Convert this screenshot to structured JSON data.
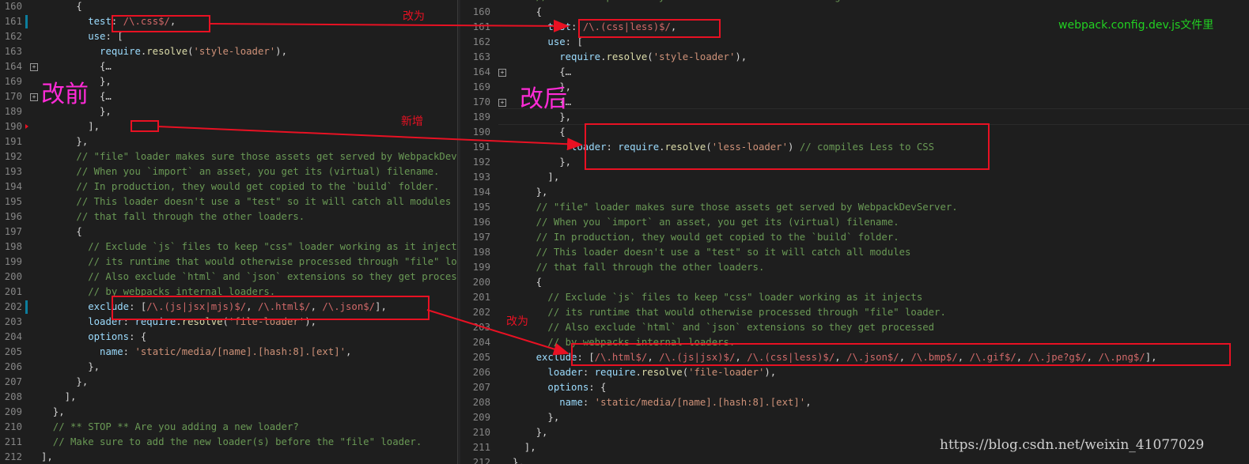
{
  "left": {
    "first_line": 160,
    "lines": [
      {
        "n": "160",
        "t": [
          [
            "      {",
            "pl"
          ]
        ]
      },
      {
        "n": "161",
        "t": [
          [
            "        ",
            "pl"
          ],
          [
            "test",
            "kw"
          ],
          [
            ": ",
            "pl"
          ],
          [
            "/\\.css$/",
            "rx"
          ],
          [
            ",",
            "pl"
          ]
        ],
        "mod": true
      },
      {
        "n": "162",
        "t": [
          [
            "        ",
            "pl"
          ],
          [
            "use",
            "kw"
          ],
          [
            ": [",
            "pl"
          ]
        ]
      },
      {
        "n": "163",
        "t": [
          [
            "          ",
            "pl"
          ],
          [
            "require",
            "kw"
          ],
          [
            ".",
            "pl"
          ],
          [
            "resolve",
            "fn"
          ],
          [
            "(",
            "pl"
          ],
          [
            "'style-loader'",
            "st"
          ],
          [
            "),",
            "pl"
          ]
        ]
      },
      {
        "n": "164",
        "t": [
          [
            "          {…",
            "pl"
          ]
        ],
        "fold": true
      },
      {
        "n": "169",
        "t": [
          [
            "          },",
            "pl"
          ]
        ]
      },
      {
        "n": "170",
        "t": [
          [
            "          {…",
            "pl"
          ]
        ],
        "fold": true
      },
      {
        "n": "189",
        "t": [
          [
            "          },",
            "pl"
          ]
        ]
      },
      {
        "n": "190",
        "t": [
          [
            "        ],",
            "pl"
          ]
        ],
        "marker": true
      },
      {
        "n": "191",
        "t": [
          [
            "      },",
            "pl"
          ]
        ]
      },
      {
        "n": "192",
        "t": [
          [
            "      // \"file\" loader makes sure those assets get served by WebpackDevServer.",
            "cm"
          ]
        ]
      },
      {
        "n": "193",
        "t": [
          [
            "      // When you `import` an asset, you get its (virtual) filename.",
            "cm"
          ]
        ]
      },
      {
        "n": "194",
        "t": [
          [
            "      // In production, they would get copied to the `build` folder.",
            "cm"
          ]
        ]
      },
      {
        "n": "195",
        "t": [
          [
            "      // This loader doesn't use a \"test\" so it will catch all modules",
            "cm"
          ]
        ]
      },
      {
        "n": "196",
        "t": [
          [
            "      // that fall through the other loaders.",
            "cm"
          ]
        ]
      },
      {
        "n": "197",
        "t": [
          [
            "      {",
            "pl"
          ]
        ]
      },
      {
        "n": "198",
        "t": [
          [
            "        // Exclude `js` files to keep \"css\" loader working as it injects",
            "cm"
          ]
        ]
      },
      {
        "n": "199",
        "t": [
          [
            "        // its runtime that would otherwise processed through \"file\" loader.",
            "cm"
          ]
        ]
      },
      {
        "n": "200",
        "t": [
          [
            "        // Also exclude `html` and `json` extensions so they get processed",
            "cm"
          ]
        ]
      },
      {
        "n": "201",
        "t": [
          [
            "        // by webpacks internal loaders.",
            "cm"
          ]
        ]
      },
      {
        "n": "202",
        "t": [
          [
            "        ",
            "pl"
          ],
          [
            "exclude",
            "kw"
          ],
          [
            ": [",
            "pl"
          ],
          [
            "/\\.(js|jsx|mjs)$/",
            "rx"
          ],
          [
            ", ",
            "pl"
          ],
          [
            "/\\.html$/",
            "rx"
          ],
          [
            ", ",
            "pl"
          ],
          [
            "/\\.json$/",
            "rx"
          ],
          [
            "],",
            "pl"
          ]
        ],
        "mod": true
      },
      {
        "n": "203",
        "t": [
          [
            "        ",
            "pl"
          ],
          [
            "loader",
            "kw"
          ],
          [
            ": ",
            "pl"
          ],
          [
            "require",
            "kw"
          ],
          [
            ".",
            "pl"
          ],
          [
            "resolve",
            "fn"
          ],
          [
            "(",
            "pl"
          ],
          [
            "'file-loader'",
            "st"
          ],
          [
            "),",
            "pl"
          ]
        ]
      },
      {
        "n": "204",
        "t": [
          [
            "        ",
            "pl"
          ],
          [
            "options",
            "kw"
          ],
          [
            ": {",
            "pl"
          ]
        ]
      },
      {
        "n": "205",
        "t": [
          [
            "          ",
            "pl"
          ],
          [
            "name",
            "kw"
          ],
          [
            ": ",
            "pl"
          ],
          [
            "'static/media/[name].[hash:8].[ext]'",
            "st"
          ],
          [
            ",",
            "pl"
          ]
        ]
      },
      {
        "n": "206",
        "t": [
          [
            "        },",
            "pl"
          ]
        ]
      },
      {
        "n": "207",
        "t": [
          [
            "      },",
            "pl"
          ]
        ]
      },
      {
        "n": "208",
        "t": [
          [
            "    ],",
            "pl"
          ]
        ]
      },
      {
        "n": "209",
        "t": [
          [
            "  },",
            "pl"
          ]
        ]
      },
      {
        "n": "210",
        "t": [
          [
            "  // ** STOP ** Are you adding a new loader?",
            "cm"
          ]
        ]
      },
      {
        "n": "211",
        "t": [
          [
            "  // Make sure to add the new loader(s) before the \"file\" loader.",
            "cm"
          ]
        ]
      },
      {
        "n": "212",
        "t": [
          [
            "],",
            "pl"
          ]
        ]
      }
    ]
  },
  "right": {
    "lines": [
      {
        "n": "159",
        "t": [
          [
            "    // In development \"style\" loader enables hot editing of CSS.",
            "cm"
          ]
        ]
      },
      {
        "n": "160",
        "t": [
          [
            "    {",
            "pl"
          ]
        ]
      },
      {
        "n": "161",
        "t": [
          [
            "      ",
            "pl"
          ],
          [
            "test",
            "kw"
          ],
          [
            ": ",
            "pl"
          ],
          [
            "/\\.(css|less)$/",
            "rx"
          ],
          [
            ",",
            "pl"
          ]
        ]
      },
      {
        "n": "162",
        "t": [
          [
            "      ",
            "pl"
          ],
          [
            "use",
            "kw"
          ],
          [
            ": [",
            "pl"
          ]
        ]
      },
      {
        "n": "163",
        "t": [
          [
            "        ",
            "pl"
          ],
          [
            "require",
            "kw"
          ],
          [
            ".",
            "pl"
          ],
          [
            "resolve",
            "fn"
          ],
          [
            "(",
            "pl"
          ],
          [
            "'style-loader'",
            "st"
          ],
          [
            "),",
            "pl"
          ]
        ]
      },
      {
        "n": "164",
        "t": [
          [
            "        {…",
            "pl"
          ]
        ],
        "fold": true
      },
      {
        "n": "169",
        "t": [
          [
            "        },",
            "pl"
          ]
        ]
      },
      {
        "n": "170",
        "t": [
          [
            "        {…",
            "pl"
          ]
        ],
        "fold": true
      },
      {
        "n": "189",
        "t": [
          [
            "        },",
            "pl"
          ]
        ]
      },
      {
        "n": "190",
        "t": [
          [
            "        {",
            "pl"
          ]
        ]
      },
      {
        "n": "191",
        "t": [
          [
            "          ",
            "pl"
          ],
          [
            "loader",
            "kw"
          ],
          [
            ": ",
            "pl"
          ],
          [
            "require",
            "kw"
          ],
          [
            ".",
            "pl"
          ],
          [
            "resolve",
            "fn"
          ],
          [
            "(",
            "pl"
          ],
          [
            "'less-loader'",
            "st"
          ],
          [
            ") ",
            "pl"
          ],
          [
            "// compiles Less to CSS",
            "cm"
          ]
        ]
      },
      {
        "n": "192",
        "t": [
          [
            "        },",
            "pl"
          ]
        ]
      },
      {
        "n": "193",
        "t": [
          [
            "      ],",
            "pl"
          ]
        ]
      },
      {
        "n": "194",
        "t": [
          [
            "    },",
            "pl"
          ]
        ]
      },
      {
        "n": "195",
        "t": [
          [
            "    // \"file\" loader makes sure those assets get served by WebpackDevServer.",
            "cm"
          ]
        ]
      },
      {
        "n": "196",
        "t": [
          [
            "    // When you `import` an asset, you get its (virtual) filename.",
            "cm"
          ]
        ]
      },
      {
        "n": "197",
        "t": [
          [
            "    // In production, they would get copied to the `build` folder.",
            "cm"
          ]
        ]
      },
      {
        "n": "198",
        "t": [
          [
            "    // This loader doesn't use a \"test\" so it will catch all modules",
            "cm"
          ]
        ]
      },
      {
        "n": "199",
        "t": [
          [
            "    // that fall through the other loaders.",
            "cm"
          ]
        ]
      },
      {
        "n": "200",
        "t": [
          [
            "    {",
            "pl"
          ]
        ]
      },
      {
        "n": "201",
        "t": [
          [
            "      // Exclude `js` files to keep \"css\" loader working as it injects",
            "cm"
          ]
        ]
      },
      {
        "n": "202",
        "t": [
          [
            "      // its runtime that would otherwise processed through \"file\" loader.",
            "cm"
          ]
        ]
      },
      {
        "n": "203",
        "t": [
          [
            "      // Also exclude `html` and `json` extensions so they get processed",
            "cm"
          ]
        ]
      },
      {
        "n": "204",
        "t": [
          [
            "      // by webpacks internal loaders.",
            "cm"
          ]
        ]
      },
      {
        "n": "205",
        "t": [
          [
            "    ",
            "pl"
          ],
          [
            "exclude",
            "kw"
          ],
          [
            ": [",
            "pl"
          ],
          [
            "/\\.html$/",
            "rx"
          ],
          [
            ", ",
            "pl"
          ],
          [
            "/\\.(js|jsx)$/",
            "rx"
          ],
          [
            ", ",
            "pl"
          ],
          [
            "/\\.(css|less)$/",
            "rx"
          ],
          [
            ", ",
            "pl"
          ],
          [
            "/\\.json$/",
            "rx"
          ],
          [
            ", ",
            "pl"
          ],
          [
            "/\\.bmp$/",
            "rx"
          ],
          [
            ", ",
            "pl"
          ],
          [
            "/\\.gif$/",
            "rx"
          ],
          [
            ", ",
            "pl"
          ],
          [
            "/\\.jpe?g$/",
            "rx"
          ],
          [
            ", ",
            "pl"
          ],
          [
            "/\\.png$/",
            "rx"
          ],
          [
            "],",
            "pl"
          ]
        ]
      },
      {
        "n": "206",
        "t": [
          [
            "      ",
            "pl"
          ],
          [
            "loader",
            "kw"
          ],
          [
            ": ",
            "pl"
          ],
          [
            "require",
            "kw"
          ],
          [
            ".",
            "pl"
          ],
          [
            "resolve",
            "fn"
          ],
          [
            "(",
            "pl"
          ],
          [
            "'file-loader'",
            "st"
          ],
          [
            "),",
            "pl"
          ]
        ]
      },
      {
        "n": "207",
        "t": [
          [
            "      ",
            "pl"
          ],
          [
            "options",
            "kw"
          ],
          [
            ": {",
            "pl"
          ]
        ]
      },
      {
        "n": "208",
        "t": [
          [
            "        ",
            "pl"
          ],
          [
            "name",
            "kw"
          ],
          [
            ": ",
            "pl"
          ],
          [
            "'static/media/[name].[hash:8].[ext]'",
            "st"
          ],
          [
            ",",
            "pl"
          ]
        ]
      },
      {
        "n": "209",
        "t": [
          [
            "      },",
            "pl"
          ]
        ]
      },
      {
        "n": "210",
        "t": [
          [
            "    },",
            "pl"
          ]
        ]
      },
      {
        "n": "211",
        "t": [
          [
            "  ],",
            "pl"
          ]
        ]
      },
      {
        "n": "212",
        "t": [
          [
            "},",
            "pl"
          ]
        ]
      }
    ]
  },
  "annotations": {
    "before_label": "改前",
    "after_label": "改后",
    "changed_label_1": "改为",
    "added_label": "新增",
    "changed_label_2": "改为",
    "file_label": "webpack.config.dev.js文件里",
    "watermark": "https://blog.csdn.net/weixin_41077029"
  },
  "colors": {
    "background": "#1e1e1e",
    "annotation_red": "#e81123",
    "before_after_magenta": "#ff2bd7",
    "file_label_green": "#22d022"
  }
}
